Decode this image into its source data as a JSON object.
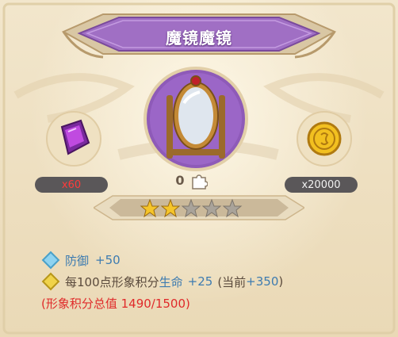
{
  "title": "魔镜魔镜",
  "left_item": {
    "icon": "purple-crystal-icon",
    "count": "x60",
    "color": "#ff3b3b"
  },
  "right_item": {
    "icon": "gold-coin-icon",
    "count": "x20000"
  },
  "center": {
    "icon": "magic-mirror-icon",
    "fragment_count": "0",
    "fragment_icon": "puzzle-piece-icon"
  },
  "stars": {
    "filled": 2,
    "total": 5
  },
  "attributes": [
    {
      "icon": "diamond-blue-icon",
      "label": "防御",
      "value": "+50"
    },
    {
      "icon": "diamond-yellow-icon",
      "text_a": "每100点形象积分",
      "stat": "生命",
      "value": "+25",
      "current_prefix": "(当前",
      "current_value": "+350",
      "current_suffix": ")"
    }
  ],
  "total_score": "(形象积分总值 1490/1500)",
  "colors": {
    "purple": "#8e5ab8",
    "gold": "#f2c020",
    "banner": "#a06fc4"
  }
}
